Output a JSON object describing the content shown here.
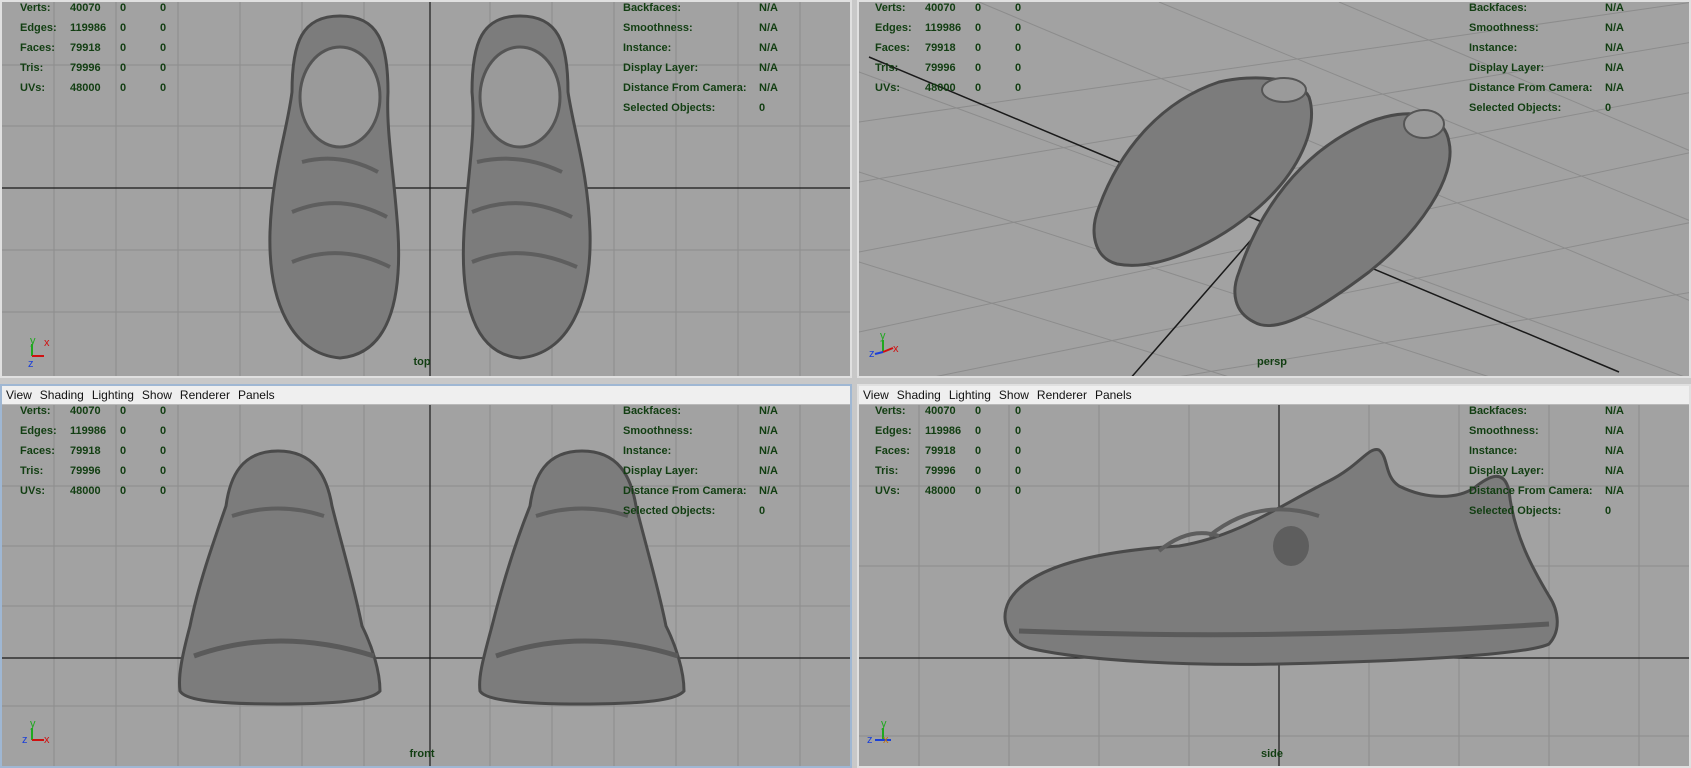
{
  "menu": [
    "View",
    "Shading",
    "Lighting",
    "Show",
    "Renderer",
    "Panels"
  ],
  "stats": [
    {
      "label": "Verts:",
      "values": [
        "40070",
        "0",
        "0"
      ]
    },
    {
      "label": "Edges:",
      "values": [
        "119986",
        "0",
        "0"
      ]
    },
    {
      "label": "Faces:",
      "values": [
        "79918",
        "0",
        "0"
      ]
    },
    {
      "label": "Tris:",
      "values": [
        "79996",
        "0",
        "0"
      ]
    },
    {
      "label": "UVs:",
      "values": [
        "48000",
        "0",
        "0"
      ]
    }
  ],
  "info": [
    {
      "label": "Backfaces:",
      "value": "N/A"
    },
    {
      "label": "Smoothness:",
      "value": "N/A"
    },
    {
      "label": "Instance:",
      "value": "N/A"
    },
    {
      "label": "Display Layer:",
      "value": "N/A"
    },
    {
      "label": "Distance From Camera:",
      "value": "N/A"
    },
    {
      "label": "Selected Objects:",
      "value": "0"
    }
  ],
  "cameras": {
    "top": "top",
    "persp": "persp",
    "front": "front",
    "side": "side"
  },
  "axes": {
    "x": "x",
    "y": "y",
    "z": "z"
  },
  "colors": {
    "viewport_bg": "#a2a2a2",
    "grid": "#8c8c8c",
    "axis_line": "#1a1a1a",
    "hud_text": "#123e12",
    "menubar_bg": "#efefef",
    "active_border": "#9fb7d3",
    "axis_x": "#d01010",
    "axis_y": "#1fa81f",
    "axis_z": "#1a3fd8",
    "shoe_dark": "#4a4a4a",
    "shoe_mid": "#7c7c7c",
    "shoe_light": "#9a9a9a"
  }
}
